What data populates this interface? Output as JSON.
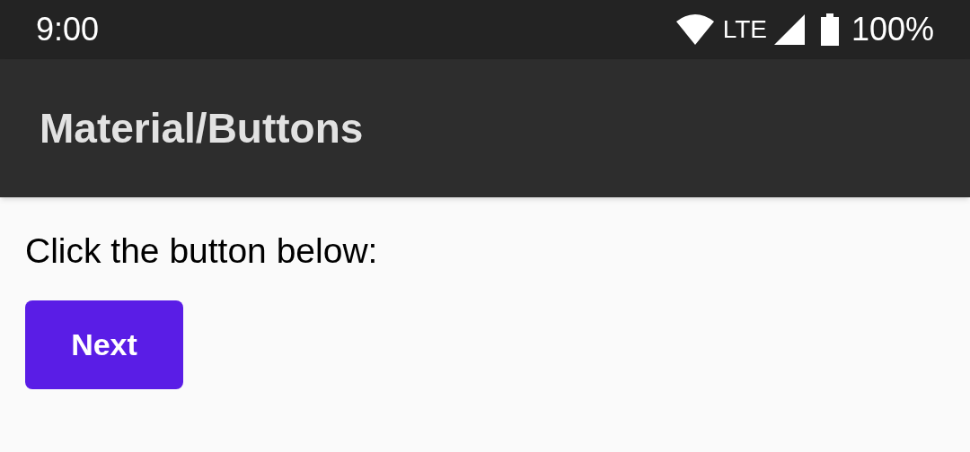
{
  "status_bar": {
    "time": "9:00",
    "network": "LTE",
    "battery": "100%"
  },
  "app_bar": {
    "title": "Material/Buttons"
  },
  "content": {
    "prompt": "Click the button below:",
    "button": "Next"
  }
}
